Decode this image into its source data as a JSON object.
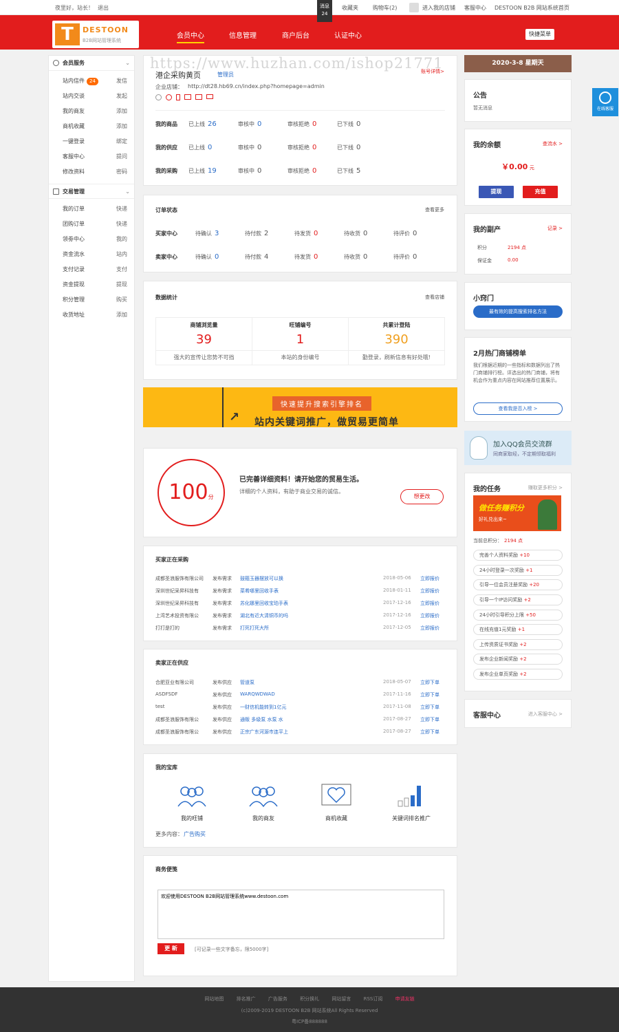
{
  "topbar": {
    "greeting": "夜里好，站长！",
    "logout": "退出",
    "msg_label": "消息",
    "msg_count": "24",
    "favorites": "收藏夹",
    "cart": "购物车(2)",
    "my_shop": "进入我的店铺",
    "service": "客服中心",
    "home": "DESTOON B2B 网站系统首页"
  },
  "header": {
    "brand": "DESTOON",
    "brand_sub": "B2B网站管理系统",
    "nav": [
      "会员中心",
      "信息管理",
      "商户后台",
      "认证中心"
    ],
    "quick_menu": "快捷菜单"
  },
  "watermark": "https://www.huzhan.com/ishop21771",
  "sidebar": {
    "group1": "会员服务",
    "items1": [
      {
        "label": "站内信件",
        "act": "发信",
        "badge": "24"
      },
      {
        "label": "站内交谈",
        "act": "发起"
      },
      {
        "label": "我的商友",
        "act": "添加"
      },
      {
        "label": "商机收藏",
        "act": "添加"
      },
      {
        "label": "一键登录",
        "act": "绑定"
      },
      {
        "label": "客服中心",
        "act": "提问"
      },
      {
        "label": "修改资料",
        "act": "密码"
      }
    ],
    "group2": "交易管理",
    "items2": [
      {
        "label": "我的订单",
        "act": "快递"
      },
      {
        "label": "团购订单",
        "act": "快递"
      },
      {
        "label": "领劵中心",
        "act": "我的"
      },
      {
        "label": "资金流水",
        "act": "站内"
      },
      {
        "label": "支付记录",
        "act": "支付"
      },
      {
        "label": "资金提现",
        "act": "提现"
      },
      {
        "label": "积分管理",
        "act": "购买"
      },
      {
        "label": "收货地址",
        "act": "添加"
      }
    ]
  },
  "profile": {
    "title": "港企采购黄页",
    "role": "管理员",
    "account_link": "账号详情>",
    "shop_label": "企业店铺：",
    "shop_url": "http://dt28.hb69.cn/index.php?homepage=admin"
  },
  "stats_rows": [
    {
      "label": "我的商品",
      "a": "26",
      "b": "0",
      "c": "0",
      "d": "0"
    },
    {
      "label": "我的供应",
      "a": "0",
      "b": "0",
      "c": "0",
      "d": "0"
    },
    {
      "label": "我的采购",
      "a": "19",
      "b": "0",
      "c": "0",
      "d": "5"
    }
  ],
  "stat_labels": {
    "a": "已上线",
    "b": "审核中",
    "c": "审核拒绝",
    "d": "已下线"
  },
  "orders": {
    "title": "订单状态",
    "more": "查看更多",
    "buyer": "买家中心",
    "seller": "卖家中心",
    "labels": [
      "待确认",
      "待付款",
      "待发货",
      "待收货",
      "待评价"
    ],
    "buyer_vals": [
      "3",
      "2",
      "0",
      "0",
      "0"
    ],
    "seller_vals": [
      "0",
      "4",
      "0",
      "0",
      "0"
    ]
  },
  "data_stats": {
    "title": "数据统计",
    "more": "查看店铺",
    "items": [
      {
        "name": "商铺浏览量",
        "value": "39",
        "desc": "强大的宣传让您势不可挡"
      },
      {
        "name": "旺铺编号",
        "value": "1",
        "desc": "本站的身份编号"
      },
      {
        "name": "共累计登陆",
        "value": "390",
        "desc": "勤登录，刷新信息有好处哦!"
      }
    ]
  },
  "banner": {
    "tag": "快速提升搜索引擎排名",
    "slogan": "站内关键词推广，做贸易更简单"
  },
  "score": {
    "value": "100",
    "unit": "分",
    "headline": "已完善详细资料！请开始您的贸易生活。",
    "desc": "详细的个人资料，有助于商业交易的诚信。",
    "button": "想更改"
  },
  "buying": {
    "title": "买家正在采购",
    "rows": [
      {
        "company": "成都圣浪服饰有限公司",
        "type": "发布需求",
        "item": "鼓箍玉器摆放可以换",
        "date": "2018-05-06",
        "action": "立即报价"
      },
      {
        "company": "深圳世纪采昇科技有",
        "type": "发布需求",
        "item": "菜肴哪里回收手表",
        "date": "2018-01-11",
        "action": "立即报价"
      },
      {
        "company": "深圳世纪采昇科技有",
        "type": "发布需求",
        "item": "苏化娜里回收宝珀手表",
        "date": "2017-12-16",
        "action": "立即报价"
      },
      {
        "company": "上湾艺术投资有限公",
        "type": "发布需求",
        "item": "湖北有近大清铜币的吗",
        "date": "2017-12-16",
        "action": "立即报价"
      },
      {
        "company": "打打是打的",
        "type": "发布需求",
        "item": "打死打死大所",
        "date": "2017-12-05",
        "action": "立即报价"
      }
    ]
  },
  "supplying": {
    "title": "卖家正在供应",
    "rows": [
      {
        "company": "合肥亚业有限公司",
        "type": "发布供应",
        "item": "管道泵",
        "date": "2018-05-07",
        "action": "立即下单"
      },
      {
        "company": "ASDFSDF",
        "type": "发布供应",
        "item": "WARQWDWAD",
        "date": "2017-11-16",
        "action": "立即下单"
      },
      {
        "company": "test",
        "type": "发布供应",
        "item": "一财信机能转到1亿元",
        "date": "2017-11-08",
        "action": "立即下单"
      },
      {
        "company": "成都圣浪服饰有限公",
        "type": "发布供应",
        "item": "通贩 多级泵 水泵 水",
        "date": "2017-08-27",
        "action": "立即下单"
      },
      {
        "company": "成都圣浪服饰有限公",
        "type": "发布供应",
        "item": "正宗广东河源市连平上",
        "date": "2017-08-27",
        "action": "立即下单"
      }
    ]
  },
  "treasury": {
    "title": "我的宝库",
    "items": [
      "我的旺铺",
      "我的商友",
      "商机收藏",
      "关键词排名推广"
    ],
    "more_label": "更多内容：",
    "more_link": "广告购买"
  },
  "memo": {
    "title": "商务便笺",
    "text": "欢迎使用DESTOON B2B网站管理系统www.destoon.com",
    "button": "更 新",
    "hint": "[可记录一些文字备忘，限5000字]"
  },
  "right": {
    "date": "2020-3-8 星期天",
    "notice_title": "公告",
    "notice_text": "暂无消息",
    "balance_title": "我的余额",
    "balance_link": "查流水 >",
    "balance_value": "￥0.00",
    "balance_unit": "元",
    "withdraw": "提现",
    "recharge": "充值",
    "assets_title": "我的副产",
    "assets_link": "记录 >",
    "points_label": "积分",
    "points_value": "2194 点",
    "deposit_label": "保证金",
    "deposit_value": "0.00",
    "tips_title": "小窍门",
    "tips_button": "最有效的提高搜索排名方法",
    "hot_title": "2月热门商铺榜单",
    "hot_text": "我们根据近期的一些指标和数据列出了热门商铺排行榜。评选出的热门商铺，将有机会作为重点内容在网站推荐位置展示。",
    "hot_button": "查看我是否入榜 >",
    "qq_title": "加入QQ会员交流群",
    "qq_sub": "同商家取经，不定期领取福利",
    "task_title": "我的任务",
    "task_link": "赚取更多积分 >",
    "task_banner": "做任务赚积分",
    "task_banner_sub": "好礼兑出来~",
    "points_now_label": "当前总积分：",
    "points_now": "2194 点",
    "tasks": [
      {
        "name": "完善个人资料奖励",
        "pt": "+10"
      },
      {
        "name": "24小时登录一次奖励",
        "pt": "+1"
      },
      {
        "name": "引导一位会员注册奖励",
        "pt": "+20"
      },
      {
        "name": "引导一个IP访问奖励",
        "pt": "+2"
      },
      {
        "name": "24小时引导积分上限",
        "pt": "+50"
      },
      {
        "name": "在线充值1元奖励",
        "pt": "+1"
      },
      {
        "name": "上传资质证书奖励",
        "pt": "+2"
      },
      {
        "name": "发布企业新闻奖励",
        "pt": "+2"
      },
      {
        "name": "发布企业单页奖励",
        "pt": "+2"
      }
    ],
    "cs_title": "客服中心",
    "cs_link": "进入客服中心 >"
  },
  "float_service": "在线客服",
  "footer": {
    "links": [
      "网站地图",
      "排名推广",
      "广告服务",
      "积分换礼",
      "网站留言",
      "RSS订阅",
      "申请友链"
    ],
    "copyright": "(c)2009-2019 DESTOON B2B 网站系统All Rights Reserved",
    "icp": "粤ICP备888888"
  },
  "colors": {
    "brand_red": "#e21d1d",
    "link_blue": "#2a6cc8",
    "accent_orange": "#f0a020"
  }
}
